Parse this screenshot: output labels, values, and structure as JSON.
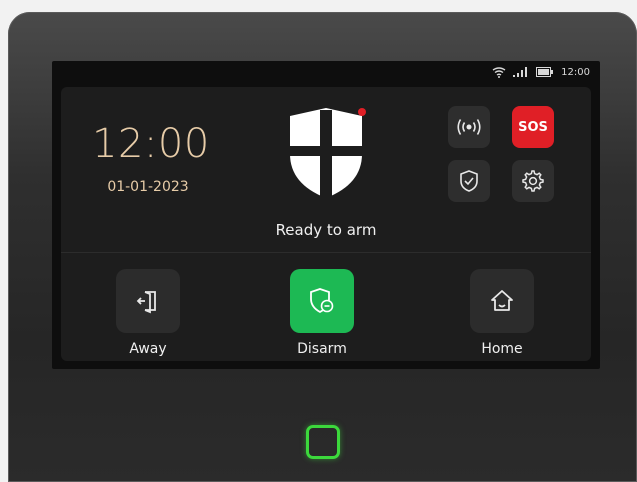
{
  "status_bar": {
    "time": "12:00",
    "icons": [
      "wifi-icon",
      "signal-icon",
      "battery-icon"
    ]
  },
  "clock": {
    "time": "12:00",
    "date": "01-01-2023"
  },
  "system": {
    "status": "Ready to arm",
    "alert_dot_color": "#e01f26"
  },
  "quick_buttons": {
    "wireless": "wireless-icon",
    "sos_label": "SOS",
    "shield": "shield-check-icon",
    "settings": "gear-icon"
  },
  "modes": [
    {
      "label": "Away",
      "icon": "away-icon",
      "active": false
    },
    {
      "label": "Disarm",
      "icon": "disarm-shield-icon",
      "active": true
    },
    {
      "label": "Home",
      "icon": "home-icon",
      "active": false
    }
  ],
  "colors": {
    "accent_green": "#1db954",
    "sos_red": "#e01f26",
    "clock_tan": "#e7cca8",
    "nfc_green": "#3cd93c"
  }
}
